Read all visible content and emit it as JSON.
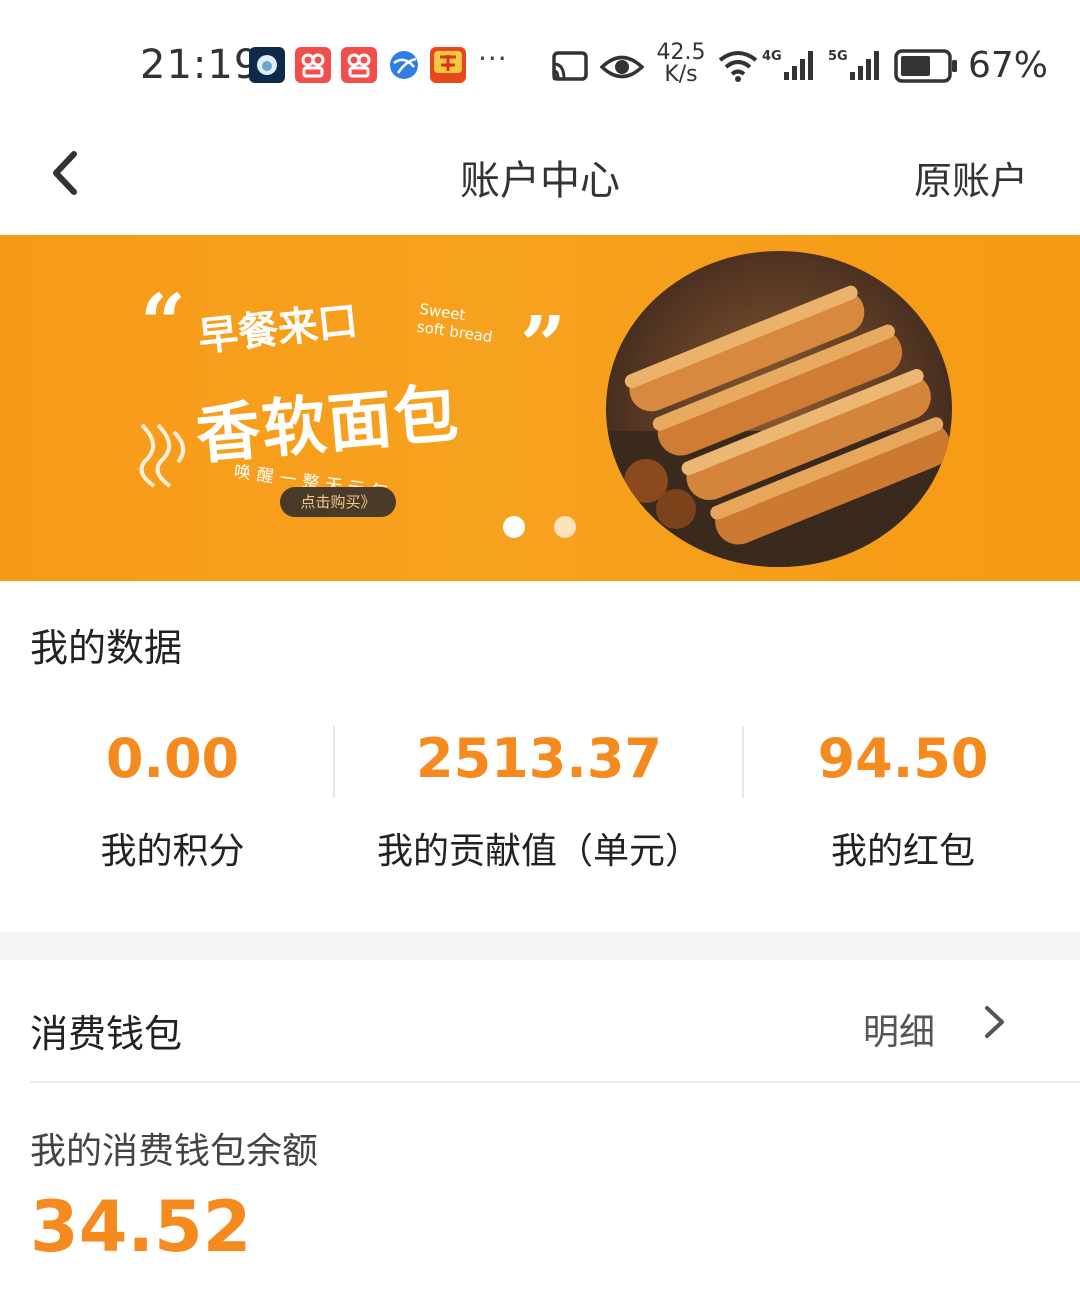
{
  "status_bar": {
    "time": "21:19",
    "net_speed_value": "42.5",
    "net_speed_unit": "K/s",
    "battery_percent": "67%",
    "more": "···",
    "signal_1_label": "4G",
    "signal_2_label": "5G",
    "icons": [
      "app-icon",
      "app-icon",
      "app-icon",
      "browser-icon",
      "taobao-icon",
      "cast-icon",
      "eye-icon",
      "wifi-icon",
      "signal-icon",
      "signal-icon",
      "battery-icon"
    ],
    "battery_level": 0.67
  },
  "nav": {
    "title": "账户中心",
    "right_label": "原账户"
  },
  "banner": {
    "line1": "早餐来口",
    "english_line1": "Sweet",
    "english_line2": "soft bread",
    "main_text": "香软面包",
    "sub_text": "唤醒一整天元气",
    "cta": "点击购买》",
    "quote_open": "“",
    "quote_close": "”",
    "slide_count": 2,
    "active_slide": 1
  },
  "my_data": {
    "title": "我的数据",
    "stats": [
      {
        "value": "0.00",
        "label": "我的积分"
      },
      {
        "value": "2513.37",
        "label": "我的贡献值（单元）"
      },
      {
        "value": "94.50",
        "label": "我的红包"
      }
    ]
  },
  "wallet": {
    "title": "消费钱包",
    "detail_label": "明细",
    "balance_label": "我的消费钱包余额",
    "balance_value": "34.52"
  },
  "colors": {
    "accent": "#f58a1f",
    "banner": "#f7a21f"
  }
}
